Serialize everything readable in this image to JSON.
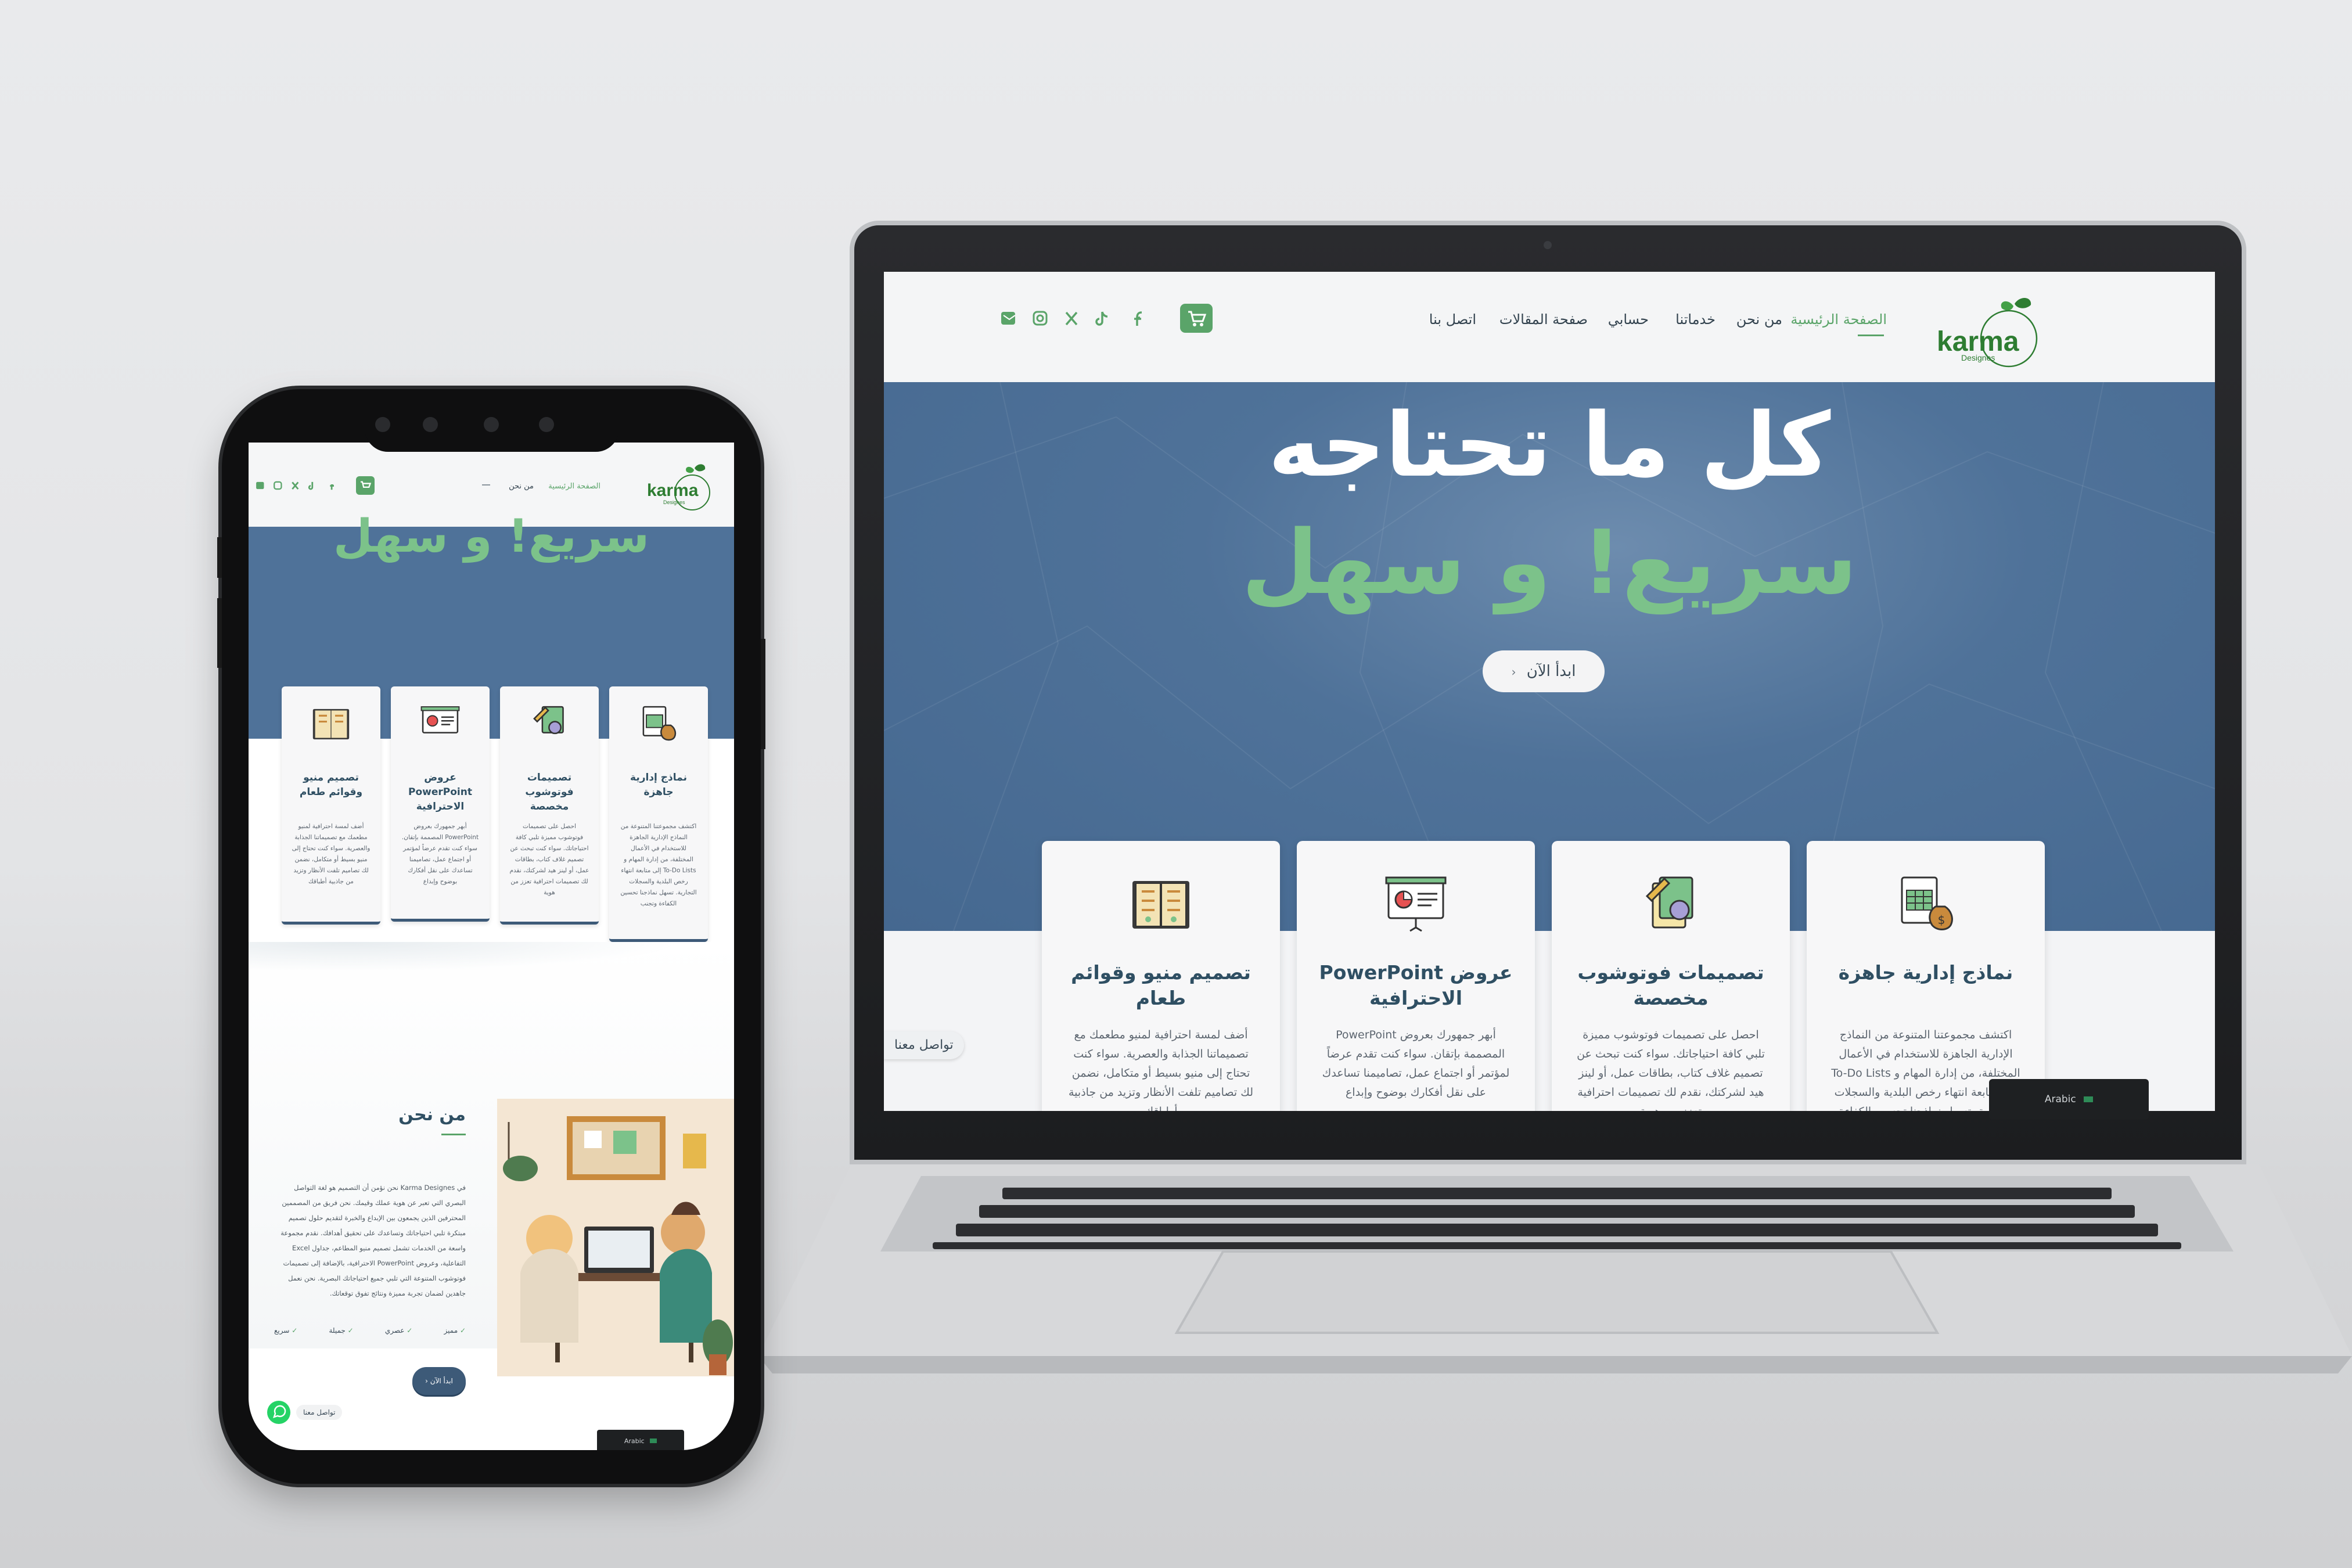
{
  "brand": {
    "name": "karma",
    "sub": "Designes",
    "accent": "#2e7d32",
    "primary": "#4f7299",
    "green_text": "#7cc28a"
  },
  "nav": {
    "items": [
      "الصفحة الرئيسية",
      "من نحن",
      "خدماتنا",
      "حسابي",
      "صفحة المقالات",
      "اتصل بنا"
    ]
  },
  "social": [
    "facebook-icon",
    "tiktok-icon",
    "x-icon",
    "instagram-icon",
    "email-icon"
  ],
  "hero": {
    "line1": "كل ما تحتاجه",
    "line2": "سريع! و سهل",
    "cta": "ابدأ الآن"
  },
  "cards": [
    {
      "title": "نماذج إدارية جاهزة",
      "text": "اكتشف مجموعتنا المتنوعة من النماذج الإدارية الجاهزة للاستخدام في الأعمال المختلفة، من إدارة المهام و To-Do Lists إلى متابعة انتهاء رخص البلدية والسجلات التجارية. تسهل نماذجنا تحسين الكفاءة وتجنب",
      "icon": "spreadsheet-money-icon"
    },
    {
      "title": "تصميمات فوتوشوب مخصصة",
      "text": "احصل على تصميمات فوتوشوب مميزة تلبي كافة احتياجاتك. سواء كنت تبحث عن تصميم غلاف كتاب، بطاقات عمل، أو لينز هيد لشركتك، نقدم لك تصميمات احترافية تعزز من هوية",
      "icon": "photoshop-design-icon"
    },
    {
      "title": "عروض PowerPoint الاحترافية",
      "text": "أبهر جمهورك بعروض PowerPoint المصممة بإتقان. سواء كنت تقدم عرضاً لمؤتمر أو اجتماع عمل، تصاميمنا تساعدك على نقل أفكارك بوضوح وإبداع",
      "icon": "presentation-board-icon"
    },
    {
      "title": "تصميم منيو وقوائم طعام",
      "text": "أضف لمسة احترافية لمنيو مطعمك مع تصميماتنا الجذابة والعصرية. سواء كنت تحتاج إلى منيو بسيط أو متكامل، نضمن لك تصاميم تلفت الأنظار وتزيد من جاذبية أطباقك",
      "icon": "menu-book-icon"
    }
  ],
  "contact_pill": "تواصل معنا",
  "language": {
    "label": "Arabic"
  },
  "phone": {
    "about_title": "من نحن",
    "about_text": "في Karma Designes نحن نؤمن أن التصميم هو لغة التواصل البصري التي تعبر عن هوية عملك وقيمك. نحن فريق من المصممين المحترفين الذين يجمعون بين الإبداع والخبرة لتقديم حلول تصميم مبتكرة تلبي احتياجاتك وتساعدك على تحقيق أهدافك. نقدم مجموعة واسعة من الخدمات تشمل تصميم منيو المطاعم، جداول Excel التفاعلية، وعروض PowerPoint الاحترافية، بالإضافة إلى تصميمات فوتوشوب المتنوعة التي تلبي جميع احتياجاتك البصرية. نحن نعمل جاهدين لضمان تجربة مميزة ونتائج تفوق توقعاتك.",
    "features": [
      "مميز",
      "عصري",
      "جميلة",
      "سريع"
    ],
    "cta": "ابدأ الآن",
    "whatsapp_label": "تواصل معنا"
  }
}
